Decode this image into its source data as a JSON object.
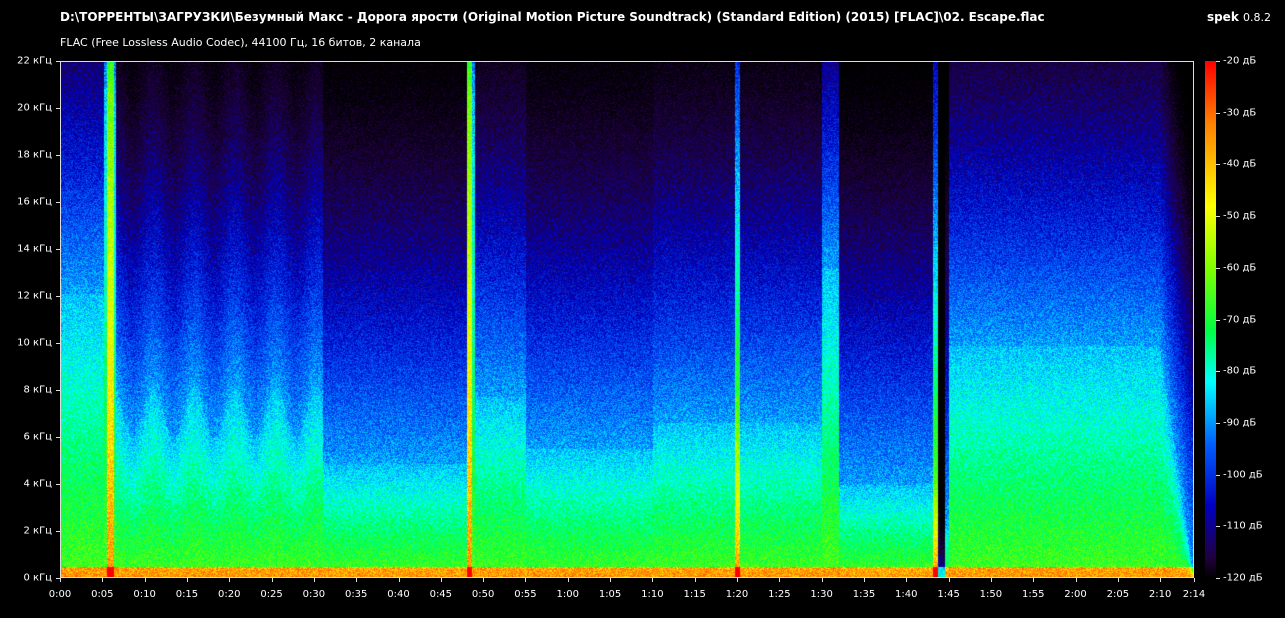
{
  "window": {
    "file_path": "D:\\ТОРРЕНТЫ\\ЗАГРУЗКИ\\Безумный Макс - Дорога ярости (Original Motion Picture Soundtrack) (Standard Edition) (2015) [FLAC]\\02. Escape.flac",
    "app_name": "spek",
    "app_version": "0.8.2",
    "format_info": "FLAC (Free Lossless Audio Codec), 44100 Гц, 16 битов, 2 канала"
  },
  "chart_data": {
    "type": "heatmap",
    "y_ticks": [
      "22 кГц",
      "20 кГц",
      "18 кГц",
      "16 кГц",
      "14 кГц",
      "12 кГц",
      "10 кГц",
      "8 кГц",
      "6 кГц",
      "4 кГц",
      "2 кГц",
      "0 кГц"
    ],
    "x_ticks": [
      "0:00",
      "0:05",
      "0:10",
      "0:15",
      "0:20",
      "0:25",
      "0:30",
      "0:35",
      "0:40",
      "0:45",
      "0:50",
      "0:55",
      "1:00",
      "1:05",
      "1:10",
      "1:15",
      "1:20",
      "1:25",
      "1:30",
      "1:35",
      "1:40",
      "1:45",
      "1:50",
      "1:55",
      "2:00",
      "2:05",
      "2:10",
      "2:14"
    ],
    "legend_ticks": [
      "-20 дБ",
      "-30 дБ",
      "-40 дБ",
      "-50 дБ",
      "-60 дБ",
      "-70 дБ",
      "-80 дБ",
      "-90 дБ",
      "-100 дБ",
      "-110 дБ",
      "-120 дБ"
    ],
    "y_range_khz": [
      0,
      22
    ],
    "x_range_s": [
      0,
      134
    ],
    "db_range": [
      -120,
      -20
    ],
    "colormap": [
      "#000000",
      "#200040",
      "#0000c0",
      "#0060ff",
      "#00ffff",
      "#00ff40",
      "#80ff00",
      "#ffff00",
      "#ff8000",
      "#ff0000"
    ]
  }
}
